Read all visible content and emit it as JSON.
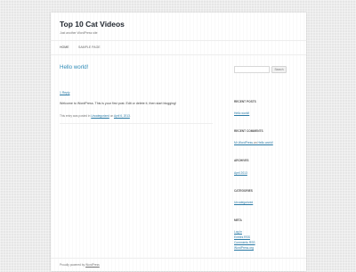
{
  "site": {
    "title": "Top 10 Cat Videos",
    "description": "Just another WordPress site"
  },
  "nav": {
    "items": [
      "HOME",
      "SAMPLE PAGE"
    ]
  },
  "post": {
    "title": "Hello world!",
    "reply": "1 Reply",
    "body": "Welcome to WordPress. This is your first post. Edit or delete it, then start blogging!",
    "meta_prefix": "This entry was posted in ",
    "category": "Uncategorized",
    "meta_middle": " on ",
    "date": "April 6, 2013",
    "meta_suffix": "."
  },
  "sidebar": {
    "search_placeholder": "",
    "search_button": "Search",
    "recent_posts": {
      "title": "RECENT POSTS",
      "items": [
        "Hello world!"
      ]
    },
    "recent_comments": {
      "title": "RECENT COMMENTS",
      "author": "Mr WordPress",
      "on": " on ",
      "post": "Hello world!"
    },
    "archives": {
      "title": "ARCHIVES",
      "items": [
        "April 2013"
      ]
    },
    "categories": {
      "title": "CATEGORIES",
      "items": [
        "Uncategorized"
      ]
    },
    "meta": {
      "title": "META",
      "items": [
        "Log in",
        "Entries RSS",
        "Comments RSS",
        "WordPress.org"
      ]
    }
  },
  "footer": {
    "prefix": "Proudly powered by ",
    "link": "WordPress"
  }
}
